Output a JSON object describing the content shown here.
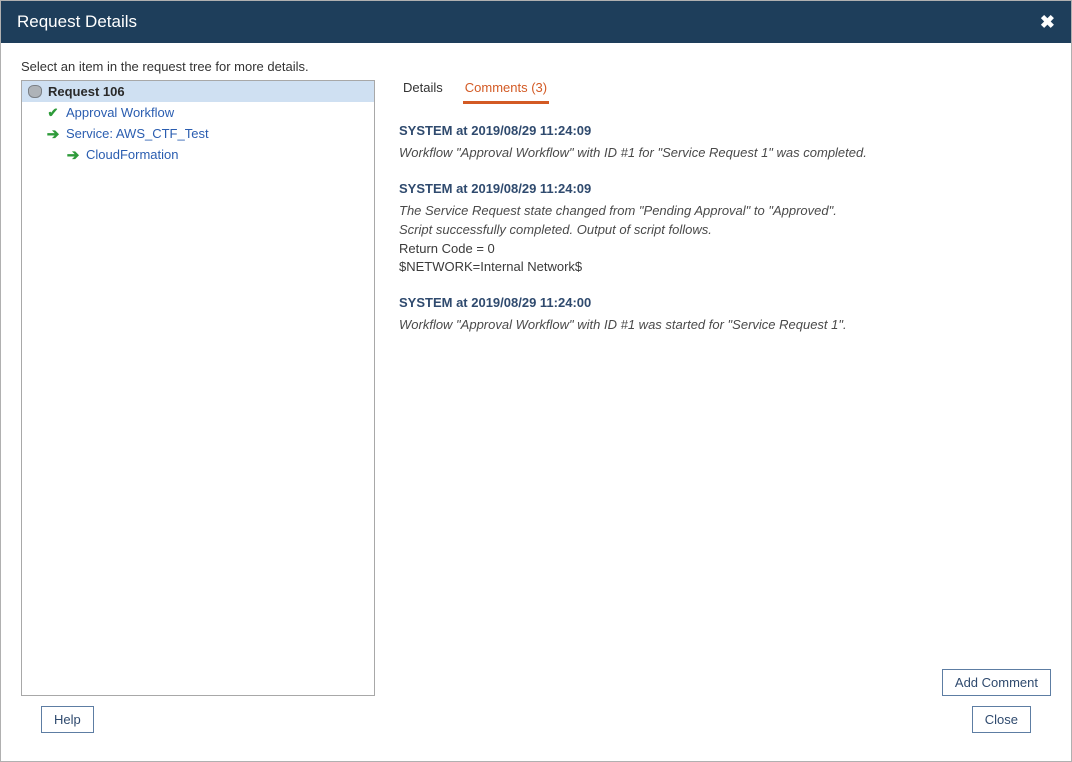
{
  "title": "Request Details",
  "instruction": "Select an item in the request tree for more details.",
  "tree": {
    "root": {
      "label": "Request 106"
    },
    "items": [
      {
        "label": "Approval Workflow",
        "icon": "check"
      },
      {
        "label": "Service: AWS_CTF_Test",
        "icon": "arrow"
      },
      {
        "label": "CloudFormation",
        "icon": "arrow",
        "depth": 2
      }
    ]
  },
  "tabs": {
    "details": "Details",
    "comments": "Comments (3)"
  },
  "comments": [
    {
      "head": "SYSTEM at 2019/08/29 11:24:09",
      "lines": [
        {
          "text": "Workflow \"Approval Workflow\" with ID #1 for \"Service Request 1\" was completed.",
          "italic": true
        }
      ]
    },
    {
      "head": "SYSTEM at 2019/08/29 11:24:09",
      "lines": [
        {
          "text": "The Service Request state changed from \"Pending Approval\" to \"Approved\".",
          "italic": true
        },
        {
          "text": "Script successfully completed. Output of script follows.",
          "italic": true
        },
        {
          "text": "Return Code = 0",
          "italic": false
        },
        {
          "text": "$NETWORK=Internal Network$",
          "italic": false
        }
      ]
    },
    {
      "head": "SYSTEM at 2019/08/29 11:24:00",
      "lines": [
        {
          "text": "Workflow \"Approval Workflow\" with ID #1 was started for \"Service Request 1\".",
          "italic": true
        }
      ]
    }
  ],
  "buttons": {
    "addComment": "Add Comment",
    "help": "Help",
    "close": "Close"
  }
}
